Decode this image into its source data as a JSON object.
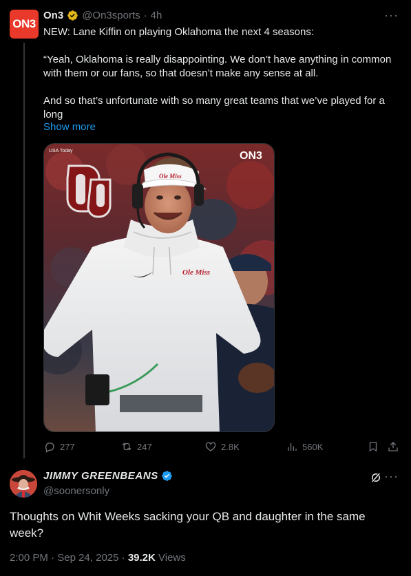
{
  "quoted_tweet": {
    "avatar_text": "ON3",
    "name": "On3",
    "handle": "@On3sports",
    "time": "4h",
    "separator": "·",
    "paragraphs": [
      "NEW: Lane Kiffin on playing Oklahoma the next 4 seasons:",
      "“Yeah, Oklahoma is really disappointing. We don’t have anything in common with them or our fans, so that doesn’t make any sense at all.",
      "And so that’s unfortunate with so many great teams that we’ve played for a long"
    ],
    "show_more": "Show more",
    "media": {
      "credit": "USA Today",
      "watermark": "ON3",
      "cap_text": "Ole Miss",
      "shirt_text": "Ole Miss"
    },
    "actions": {
      "replies": "277",
      "reposts": "247",
      "likes": "2.8K",
      "views": "560K"
    }
  },
  "main_tweet": {
    "name": "JIMMY GREENBEANS",
    "handle": "@soonersonly",
    "text": "Thoughts on Whit Weeks sacking your QB and daughter in the same week?",
    "time": "2:00 PM",
    "date": "Sep 24, 2025",
    "views_count": "39.2K",
    "views_label": "Views",
    "separator": "·"
  },
  "colors": {
    "background": "#000000",
    "text": "#e7e9ea",
    "muted": "#71767b",
    "link": "#1d9bf0",
    "gold_badge": "#e2b719",
    "blue_badge": "#1d9bf0",
    "on3_red": "#e8392b"
  },
  "icons": {
    "reply": "reply-icon",
    "repost": "repost-icon",
    "like": "heart-icon",
    "views": "views-icon",
    "bookmark": "bookmark-icon",
    "share": "share-icon",
    "more": "more-icon",
    "grok": "grok-icon",
    "verified": "verified-icon"
  }
}
